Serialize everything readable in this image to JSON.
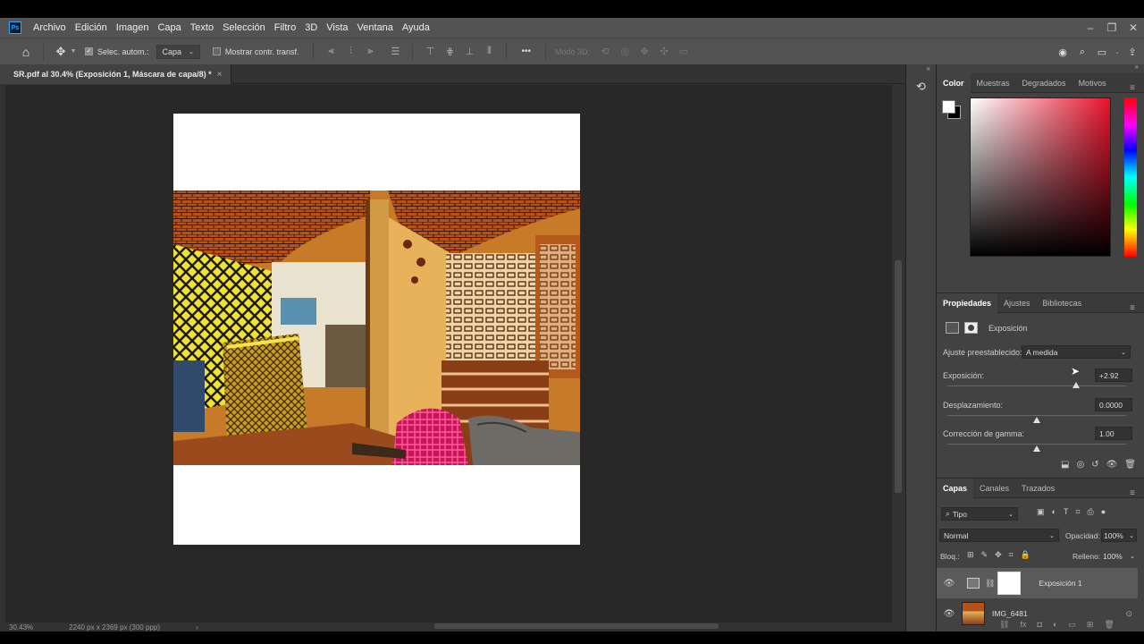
{
  "menubar": {
    "logo": "Ps",
    "items": [
      "Archivo",
      "Edición",
      "Imagen",
      "Capa",
      "Texto",
      "Selección",
      "Filtro",
      "3D",
      "Vista",
      "Ventana",
      "Ayuda"
    ],
    "window_controls": [
      "minimize-icon",
      "restore-icon",
      "close-icon"
    ]
  },
  "options": {
    "auto_select_label": "Selec. autom.:",
    "auto_select_checked": true,
    "auto_select_target": "Capa",
    "show_transform_label": "Mostrar contr. transf.",
    "show_transform_checked": false,
    "mode3d_label": "Modo 3D:",
    "more_label": "•••"
  },
  "document": {
    "tab_title": "SR.pdf al 30.4% (Exposición 1, Máscara de capa/8) *",
    "close_glyph": "×"
  },
  "status": {
    "zoom": "30.43%",
    "dimensions": "2240 px x 2369 px (300 ppp)",
    "arrow": "›"
  },
  "color_panel": {
    "tabs": [
      "Color",
      "Muestras",
      "Degradados",
      "Motivos"
    ],
    "active_tab": "Color",
    "foreground": "#ffffff",
    "background": "#000000",
    "hue_color": "#e8142c"
  },
  "properties_panel": {
    "tabs": [
      "Propiedades",
      "Ajustes",
      "Bibliotecas"
    ],
    "active_tab": "Propiedades",
    "layer_title": "Exposición",
    "preset_label": "Ajuste preestablecido:",
    "preset_value": "A medida",
    "exposure_label": "Exposición:",
    "exposure_value": "+2.92",
    "exposure_pos": 0.72,
    "offset_label": "Desplazamiento:",
    "offset_value": "0.0000",
    "offset_pos": 0.5,
    "gamma_label": "Corrección de gamma:",
    "gamma_value": "1.00",
    "gamma_pos": 0.5
  },
  "layers_panel": {
    "tabs": [
      "Capas",
      "Canales",
      "Trazados"
    ],
    "active_tab": "Capas",
    "filter_label": "Tipo",
    "blend_mode": "Normal",
    "opacity_label": "Opacidad:",
    "opacity_value": "100%",
    "lock_label": "Bloq.:",
    "fill_label": "Relleno:",
    "fill_value": "100%",
    "layers": [
      {
        "name": "Exposición 1",
        "selected": true,
        "visible": true
      },
      {
        "name": "IMG_6481",
        "selected": false,
        "visible": true
      }
    ]
  }
}
